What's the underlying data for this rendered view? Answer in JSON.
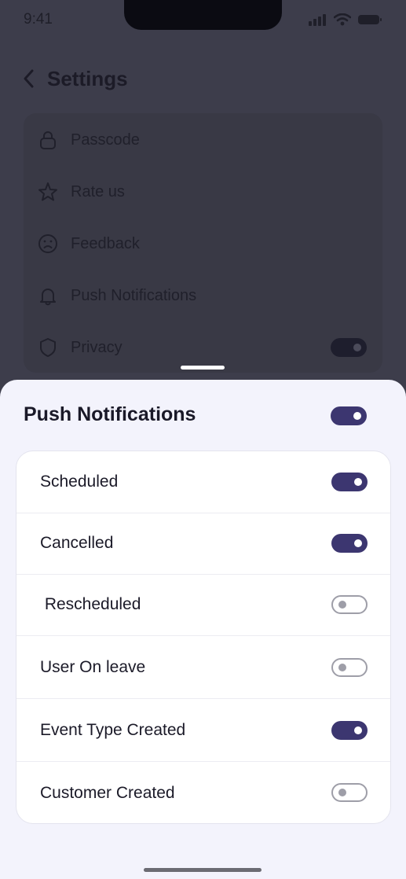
{
  "status": {
    "time": "9:41"
  },
  "background": {
    "title": "Settings",
    "items": [
      {
        "label": "Passcode",
        "icon": "lock-icon"
      },
      {
        "label": "Rate us",
        "icon": "star-icon"
      },
      {
        "label": "Feedback",
        "icon": "sad-face-icon"
      },
      {
        "label": "Push Notifications",
        "icon": "bell-icon"
      },
      {
        "label": "Privacy",
        "icon": "shield-icon",
        "toggle": true
      }
    ]
  },
  "sheet": {
    "title": "Push Notifications",
    "master_enabled": true,
    "rows": [
      {
        "label": "Scheduled",
        "enabled": true
      },
      {
        "label": "Cancelled",
        "enabled": true
      },
      {
        "label": " Rescheduled",
        "enabled": false
      },
      {
        "label": "User On leave",
        "enabled": false
      },
      {
        "label": "Event Type Created",
        "enabled": true
      },
      {
        "label": "Customer Created",
        "enabled": false
      }
    ]
  },
  "colors": {
    "accent": "#3c3670",
    "sheet_bg": "#f3f3fc",
    "overlay": "#3d3d4b"
  }
}
